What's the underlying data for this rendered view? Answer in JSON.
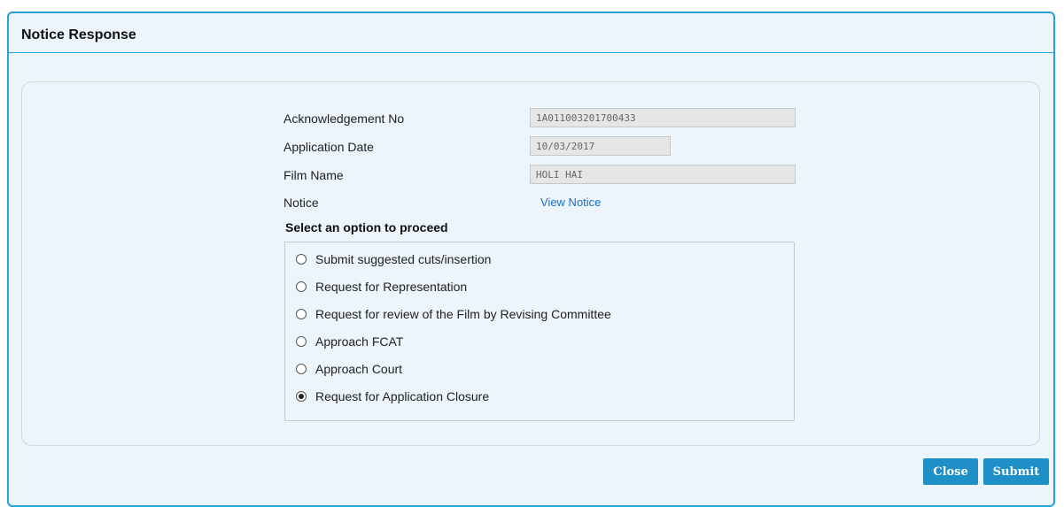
{
  "dialog": {
    "title": "Notice Response"
  },
  "form": {
    "acknowledgement_label": "Acknowledgement No",
    "acknowledgement_value": "1A011003201700433",
    "application_date_label": "Application Date",
    "application_date_value": "10/03/2017",
    "film_name_label": "Film Name",
    "film_name_value": "HOLI HAI",
    "notice_label": "Notice",
    "notice_link": "View Notice"
  },
  "options": {
    "heading": "Select an option to proceed",
    "items": [
      {
        "label": "Submit suggested cuts/insertion",
        "checked": false
      },
      {
        "label": "Request for Representation",
        "checked": false
      },
      {
        "label": "Request for review of the Film by Revising Committee",
        "checked": false
      },
      {
        "label": "Approach FCAT",
        "checked": false
      },
      {
        "label": "Approach Court",
        "checked": false
      },
      {
        "label": "Request for Application Closure",
        "checked": true
      }
    ]
  },
  "buttons": {
    "close_label": "Close",
    "submit_label": "Submit"
  },
  "colors": {
    "accent": "#2a9fd6",
    "button": "#1f8fc7",
    "link": "#1a6fc4",
    "background": "#ebf5fb"
  }
}
